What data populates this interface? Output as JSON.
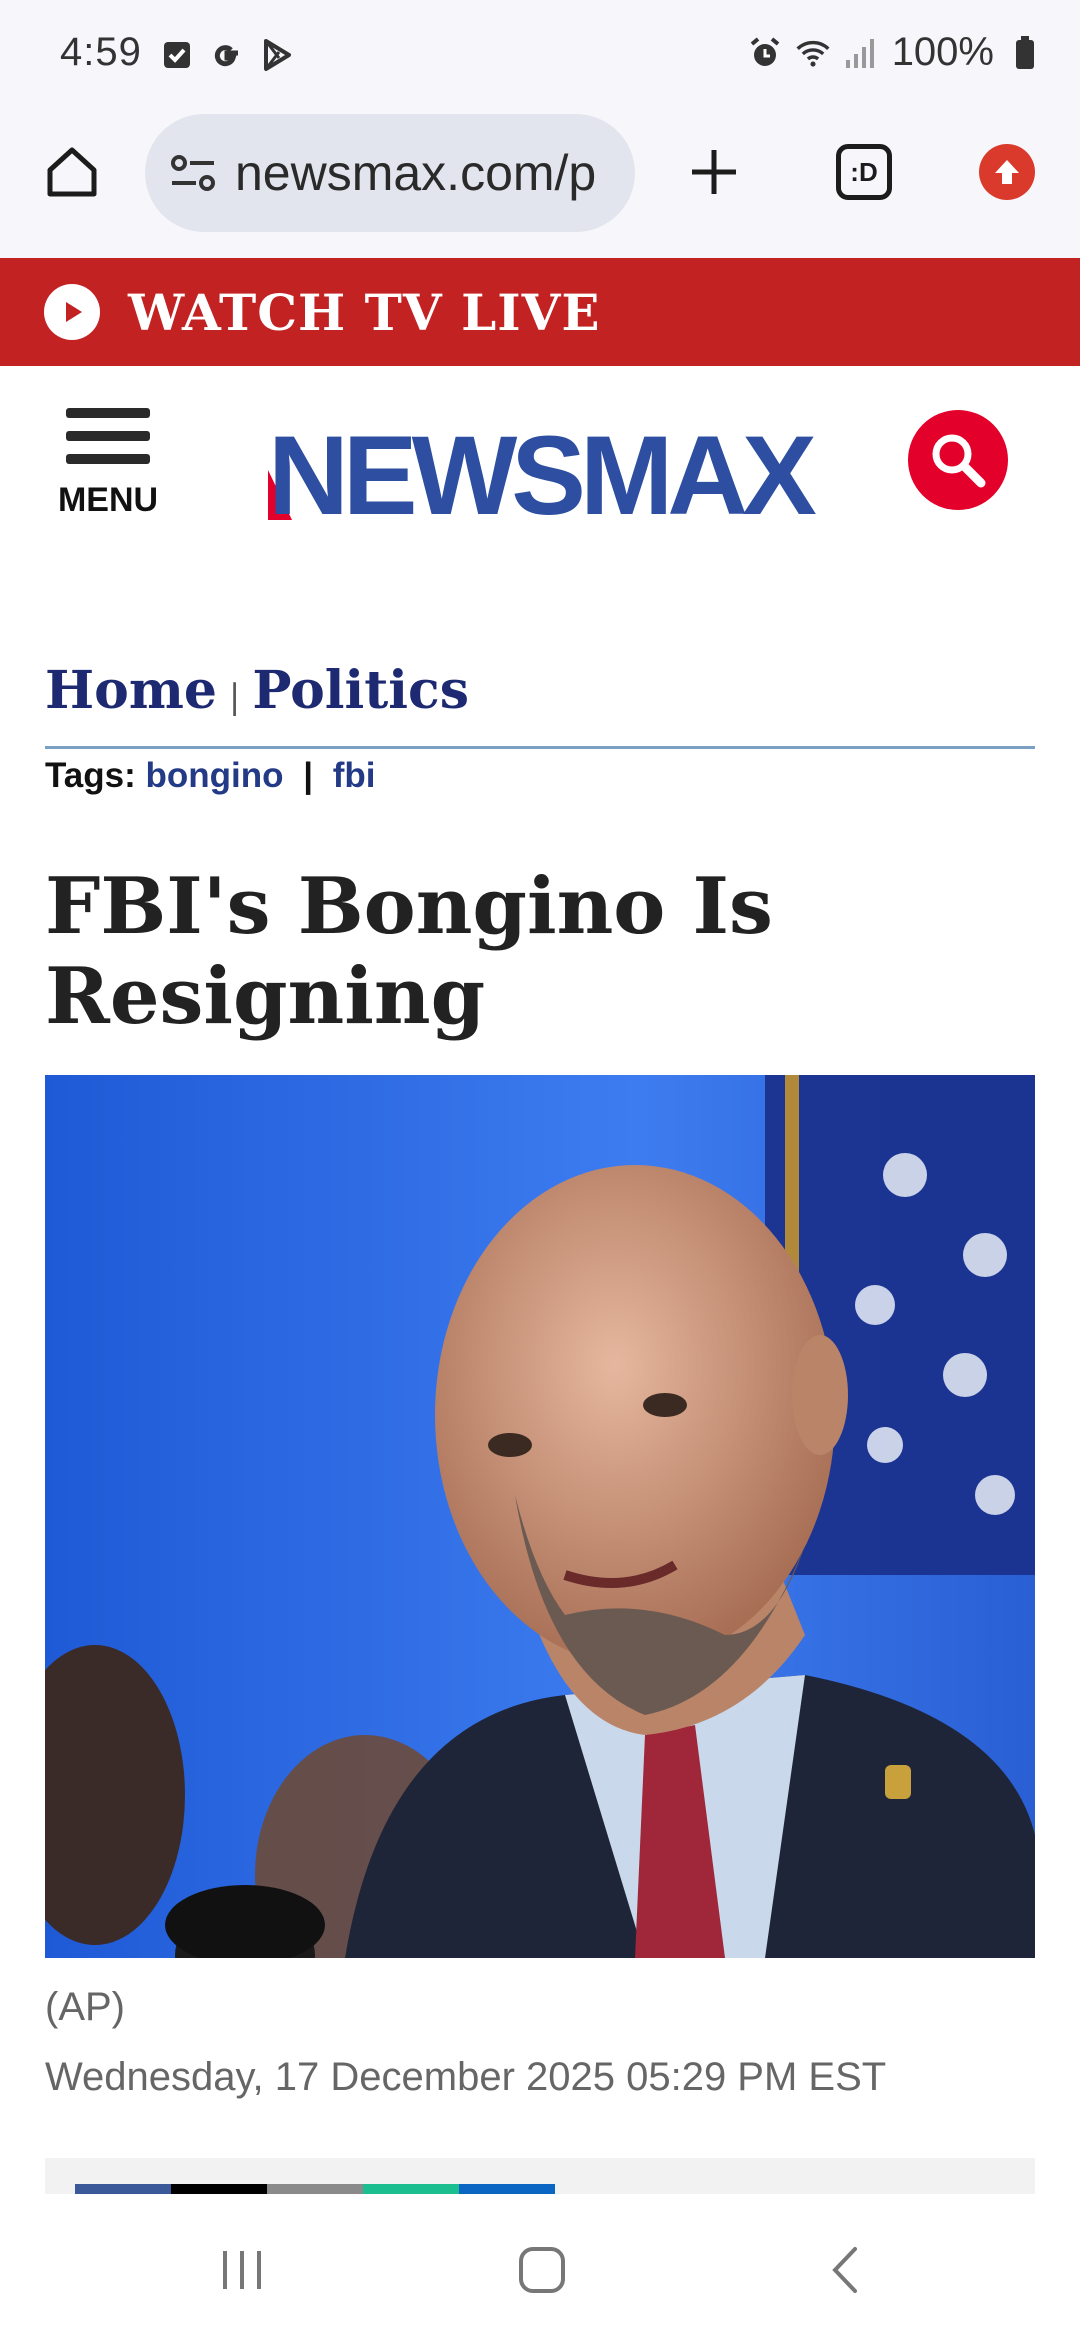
{
  "status_bar": {
    "time": "4:59",
    "battery": "100%",
    "left_icons": [
      "checkbox-icon",
      "google-icon",
      "play-store-icon"
    ],
    "right_icons": [
      "alarm-icon",
      "wifi-icon",
      "signal-icon",
      "battery-icon"
    ]
  },
  "browser": {
    "url": "newsmax.com/p",
    "tabs_label": ":D",
    "icons": [
      "home-icon",
      "tune-icon",
      "plus-icon",
      "tabs-icon",
      "update-icon"
    ]
  },
  "banner": {
    "label": "WATCH TV LIVE"
  },
  "header": {
    "menu_label": "MENU",
    "logo_text": "NEWSMAX"
  },
  "breadcrumb": {
    "home": "Home",
    "separator": "|",
    "section": "Politics"
  },
  "tags": {
    "prefix": "Tags:",
    "items": [
      "bongino",
      "fbi"
    ],
    "separator": "|"
  },
  "article": {
    "headline_line1": "FBI's Bongino Is",
    "headline_line2": "Resigning",
    "photo_credit": "(AP)",
    "dateline": "Wednesday, 17 December 2025 05:29 PM EST"
  },
  "colors": {
    "banner_red": "#c22222",
    "logo_blue": "#2e4fa1",
    "logo_red": "#e3002b",
    "breadcrumb_navy": "#1d2a72",
    "share_colors": [
      "#3b5998",
      "#000000",
      "#8a8a8a",
      "#1bbf8f",
      "#0a66c2"
    ]
  }
}
